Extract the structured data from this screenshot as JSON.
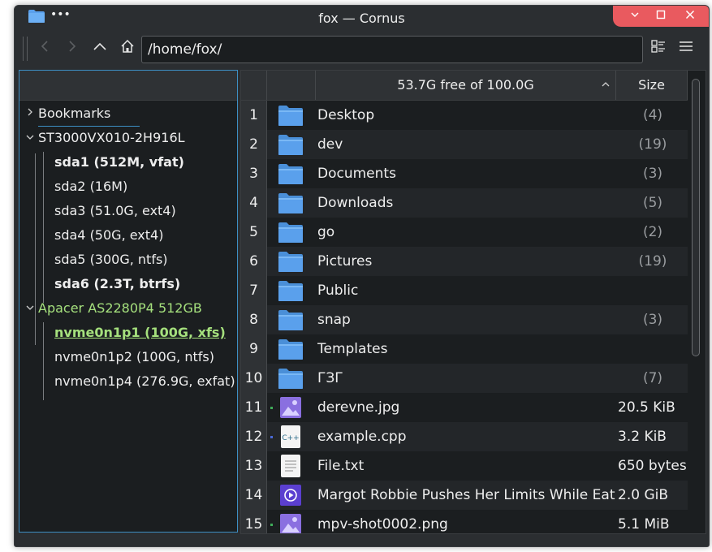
{
  "window": {
    "title": "fox — Cornus",
    "menu_dots": "•••"
  },
  "toolbar": {
    "path": "/home/fox/"
  },
  "sidebar": {
    "bookmarks": "Bookmarks",
    "disk1": "ST3000VX010-2H916L",
    "disk1_parts": [
      "sda1 (512M, vfat)",
      "sda2 (16M)",
      "sda3 (51.0G, ext4)",
      "sda4 (50G, ext4)",
      "sda5 (300G, ntfs)",
      "sda6 (2.3T, btrfs)"
    ],
    "disk2": "Apacer AS2280P4 512GB",
    "disk2_parts": [
      "nvme0n1p1 (100G, xfs)",
      "nvme0n1p2 (100G, ntfs)",
      "nvme0n1p4 (276.9G, exfat)"
    ]
  },
  "table": {
    "header_free": "53.7G free of 100.0G",
    "header_size": "Size",
    "rows": [
      {
        "n": "1",
        "name": "Desktop",
        "size": "(4)",
        "type": "folder"
      },
      {
        "n": "2",
        "name": "dev",
        "size": "(19)",
        "type": "folder"
      },
      {
        "n": "3",
        "name": "Documents",
        "size": "(3)",
        "type": "folder"
      },
      {
        "n": "4",
        "name": "Downloads",
        "size": "(5)",
        "type": "folder"
      },
      {
        "n": "5",
        "name": "go",
        "size": "(2)",
        "type": "folder"
      },
      {
        "n": "6",
        "name": "Pictures",
        "size": "(19)",
        "type": "folder"
      },
      {
        "n": "7",
        "name": "Public",
        "size": "",
        "type": "folder"
      },
      {
        "n": "8",
        "name": "snap",
        "size": "(3)",
        "type": "folder"
      },
      {
        "n": "9",
        "name": "Templates",
        "size": "",
        "type": "folder"
      },
      {
        "n": "10",
        "name": "ГЗГ",
        "size": "(7)",
        "type": "folder"
      },
      {
        "n": "11",
        "name": "derevne.jpg",
        "size": "20.5 KiB",
        "type": "image"
      },
      {
        "n": "12",
        "name": "example.cpp",
        "size": "3.2 KiB",
        "type": "cpp"
      },
      {
        "n": "13",
        "name": "File.txt",
        "size": "650 bytes",
        "type": "text"
      },
      {
        "n": "14",
        "name": "Margot Robbie Pushes Her Limits While Eating",
        "size": "2.0 GiB",
        "type": "video"
      },
      {
        "n": "15",
        "name": "mpv-shot0002.png",
        "size": "5.1 MiB",
        "type": "image"
      }
    ]
  },
  "colors": {
    "folder": "#5aa0ec",
    "accent": "#3d8fc4",
    "mounted": "#a5e07d",
    "close": "#e95a5f"
  }
}
